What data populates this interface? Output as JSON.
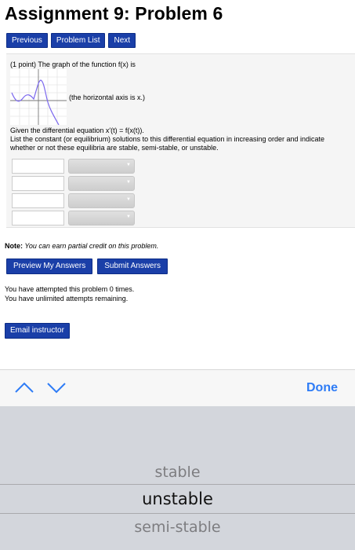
{
  "page": {
    "title": "Assignment 9: Problem 6"
  },
  "nav": {
    "previous": "Previous",
    "problem_list": "Problem List",
    "next": "Next"
  },
  "problem": {
    "intro": "(1 point) The graph of the function f(x) is",
    "graph_caption": "(the horizontal axis is x.)",
    "line1": "Given the differential equation x′(t) = f(x(t)).",
    "line2": "List the constant (or equilibrium) solutions to this differential equation in increasing order and indicate",
    "line3": "whether or not these equilibria are stable, semi-stable, or unstable."
  },
  "answers": [
    {
      "value": "",
      "select": ""
    },
    {
      "value": "",
      "select": ""
    },
    {
      "value": "",
      "select": ""
    },
    {
      "value": "",
      "select": ""
    }
  ],
  "note": {
    "label": "Note:",
    "text": " You can earn partial credit on this problem."
  },
  "actions": {
    "preview": "Preview My Answers",
    "submit": "Submit Answers"
  },
  "attempts": {
    "line1": "You have attempted this problem 0 times.",
    "line2": "You have unlimited attempts remaining."
  },
  "email": "Email instructor",
  "keyboard": {
    "done": "Done"
  },
  "picker": {
    "options": [
      "stable",
      "unstable",
      "semi-stable"
    ],
    "selected": "unstable"
  },
  "colors": {
    "button": "#1a3fa8",
    "done": "#2e7cf6",
    "curve": "#7b68ee",
    "picker_bg": "#d3d6dc"
  }
}
